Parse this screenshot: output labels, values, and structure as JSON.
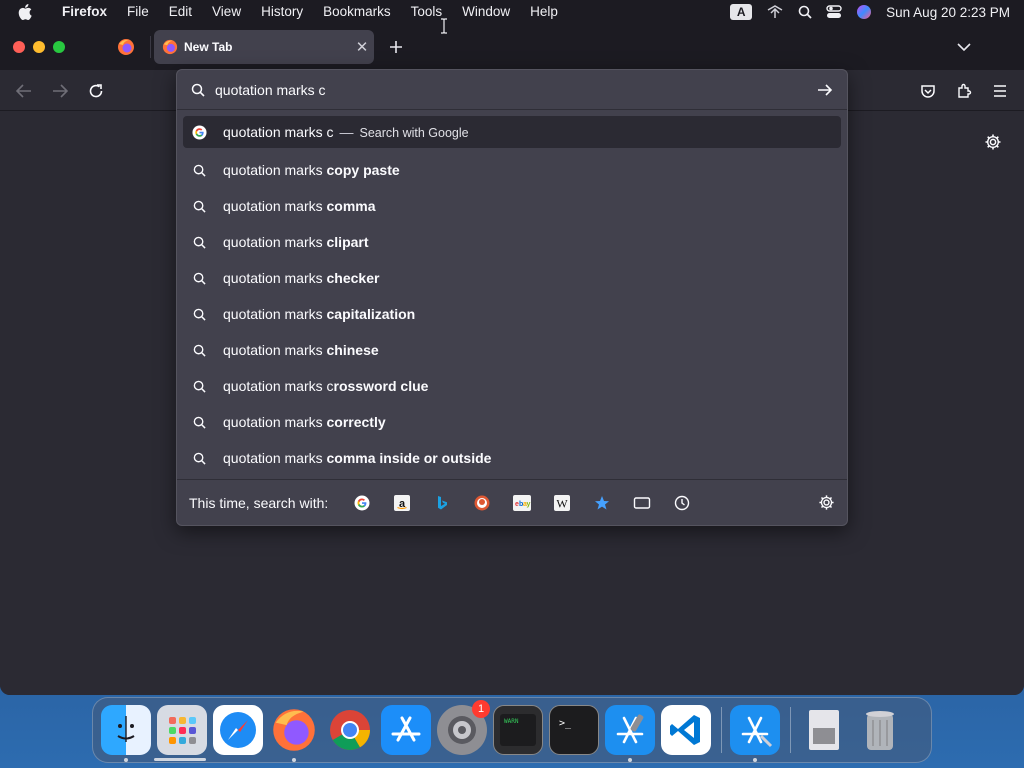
{
  "menubar": {
    "app": "Firefox",
    "items": [
      "File",
      "Edit",
      "View",
      "History",
      "Bookmarks",
      "Tools",
      "Window",
      "Help"
    ],
    "input_source": "A",
    "clock": "Sun Aug 20  2:23 PM"
  },
  "tab": {
    "title": "New Tab"
  },
  "urlbar": {
    "value": "quotation marks c",
    "first_result": {
      "text": "quotation marks c",
      "action": "Search with Google"
    },
    "suggestions": [
      {
        "prefix": "quotation marks ",
        "bold": "copy paste"
      },
      {
        "prefix": "quotation marks ",
        "bold": "comma"
      },
      {
        "prefix": "quotation marks ",
        "bold": "clipart"
      },
      {
        "prefix": "quotation marks ",
        "bold": "checker"
      },
      {
        "prefix": "quotation marks ",
        "bold": "capitalization"
      },
      {
        "prefix": "quotation marks ",
        "bold": "chinese"
      },
      {
        "prefix": "quotation marks c",
        "bold": "rossword clue"
      },
      {
        "prefix": "quotation marks ",
        "bold": "correctly"
      },
      {
        "prefix": "quotation marks ",
        "bold": "comma inside or outside"
      }
    ],
    "oneoff_label": "This time, search with:",
    "engines": [
      "google-icon",
      "amazon-icon",
      "bing-icon",
      "duckduckgo-icon",
      "ebay-icon",
      "wikipedia-icon",
      "bookmarks-icon",
      "tabs-icon",
      "history-icon"
    ]
  },
  "dock": {
    "apps": [
      "Finder",
      "Launchpad",
      "Safari",
      "Firefox",
      "Chrome",
      "App Store",
      "System Settings",
      "Console",
      "Terminal",
      "Xcode",
      "Visual Studio Code",
      "Simulator",
      "Preview",
      "Trash"
    ],
    "settings_badge": "1"
  },
  "colors": {
    "window_bg": "#2b2a33",
    "panel_bg": "#42414d",
    "toolbar_bg": "#1c1b22"
  }
}
